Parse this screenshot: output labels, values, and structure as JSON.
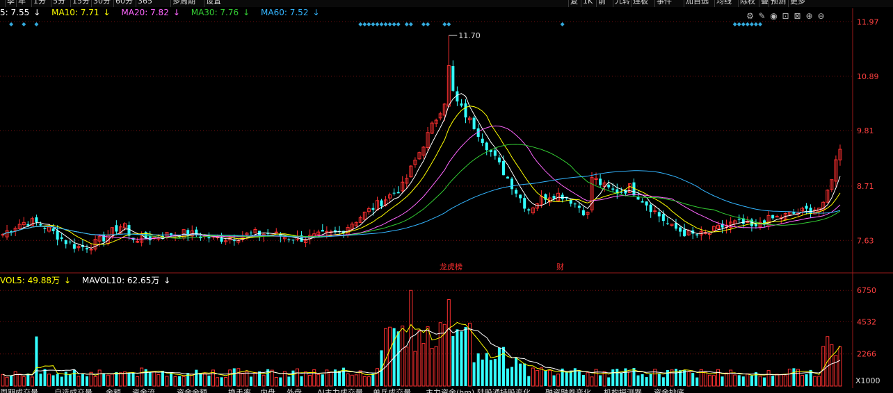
{
  "top_tabs": [
    "季",
    "年",
    "1分",
    "5分",
    "15分",
    "30分",
    "60分",
    "365",
    "多周期",
    "设置",
    "复",
    "1K",
    "前",
    "九转",
    "连板",
    "事件",
    "加自选",
    "均线",
    "除权",
    "叠",
    "预测",
    "更多"
  ],
  "ma_legend": [
    {
      "label": "5: 7.55",
      "arrow": "↓",
      "color": "#ffffff"
    },
    {
      "label": "MA10: 7.71",
      "arrow": "↓",
      "color": "#ffff00"
    },
    {
      "label": "MA20: 7.82",
      "arrow": "↓",
      "color": "#ff66ff"
    },
    {
      "label": "MA30: 7.76",
      "arrow": "↓",
      "color": "#33cc33"
    },
    {
      "label": "MA60: 7.52",
      "arrow": "↓",
      "color": "#33b5ff"
    }
  ],
  "vol_legend": [
    {
      "label": "VOL5: 49.88万",
      "arrow": "↓",
      "color": "#ffff00"
    },
    {
      "label": "MAVOL10: 62.65万",
      "arrow": "↓",
      "color": "#ffffff"
    }
  ],
  "price_axis": {
    "ticks": [
      "11.97",
      "10.89",
      "9.81",
      "8.71",
      "7.63"
    ],
    "values": [
      11.97,
      10.89,
      9.81,
      8.71,
      7.63
    ]
  },
  "volume_axis": {
    "ticks": [
      "6750",
      "4532",
      "2266"
    ],
    "unit": "X1000"
  },
  "peak_annotation": "11.70",
  "event_markers": [
    {
      "label": "龙虎榜"
    },
    {
      "label": "财"
    }
  ],
  "bottom_tabs": [
    "周期成交量",
    "自选成交量",
    "金额",
    "资金流",
    "资金余额",
    "换手率",
    "内盘",
    "外盘",
    "AI主力成交量",
    "单兵成交量",
    "主力资金(hm)",
    "陆股通持股变化",
    "融资融券变化",
    "机构探测器",
    "资金抄底"
  ],
  "icons": [
    "settings-icon",
    "brush-icon",
    "eye-icon",
    "lock-icon",
    "gift-icon",
    "plus-icon",
    "minus-icon"
  ],
  "colors": {
    "up": "#ff3030",
    "down": "#33ffff",
    "grid": "#7a1010",
    "ma5": "#ffffff",
    "ma10": "#ffff00",
    "ma20": "#ff66ff",
    "ma30": "#33cc33",
    "ma60": "#33b5ff",
    "diamond": "#33aadd"
  }
}
